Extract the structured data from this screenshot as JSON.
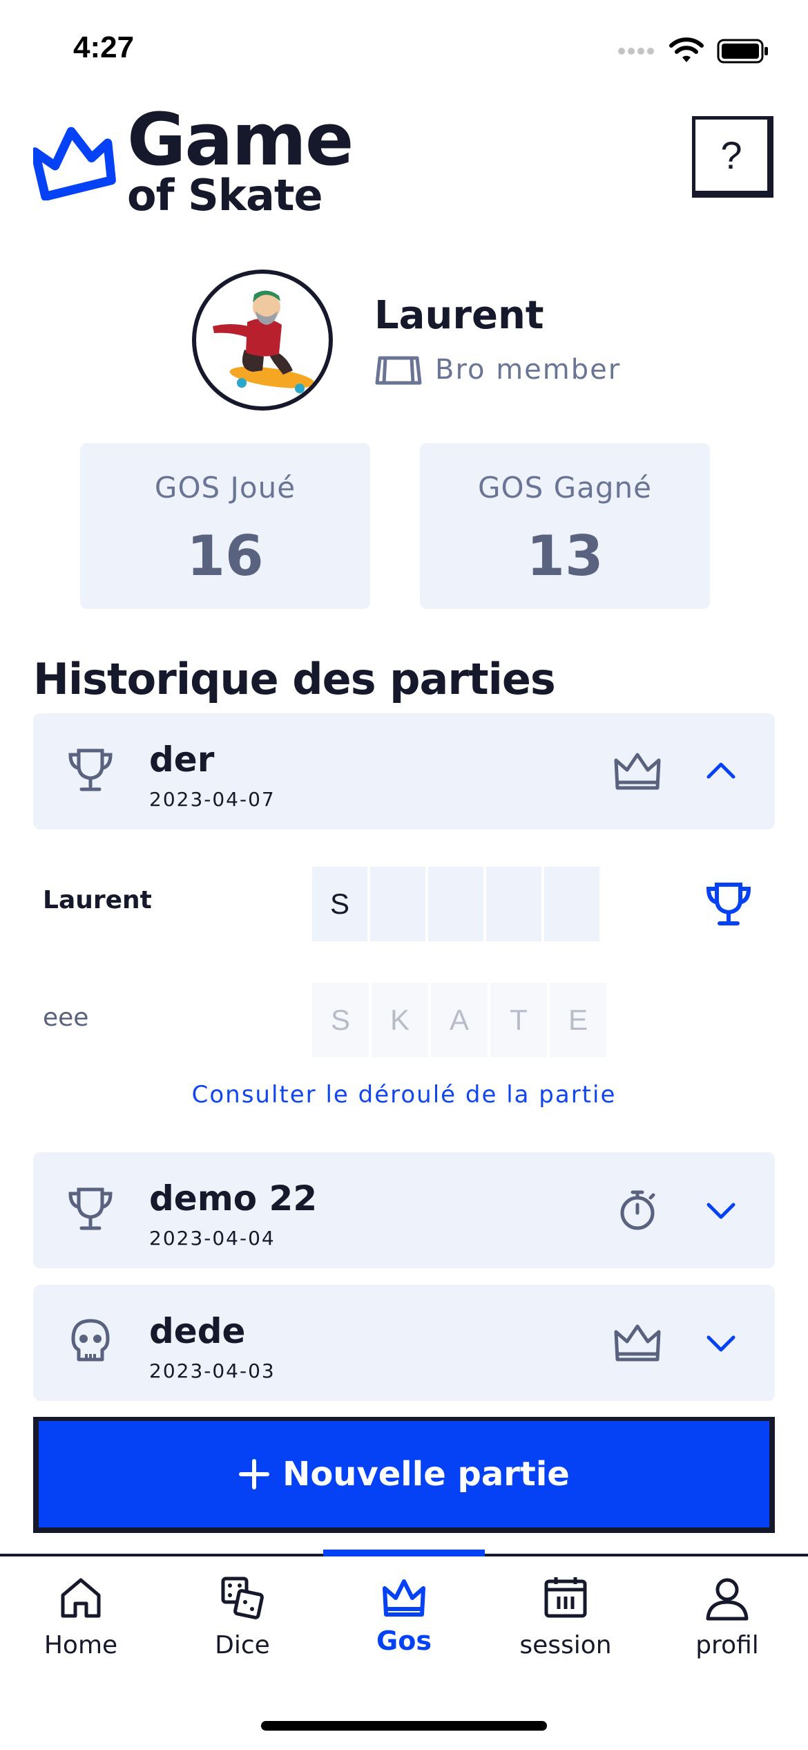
{
  "status_bar": {
    "time": "4:27"
  },
  "header": {
    "logo_line1": "Game",
    "logo_line2": "of Skate",
    "help_label": "?"
  },
  "profile": {
    "name": "Laurent",
    "membership": "Bro member"
  },
  "stats": [
    {
      "label": "GOS Joué",
      "value": "16"
    },
    {
      "label": "GOS Gagné",
      "value": "13"
    }
  ],
  "history": {
    "title": "Historique des parties",
    "games": [
      {
        "name": "der",
        "date": "2023-04-07",
        "result_icon": "trophy-icon",
        "mode_icon": "crown-icon",
        "expanded": true
      },
      {
        "name": "demo 22",
        "date": "2023-04-04",
        "result_icon": "trophy-icon",
        "mode_icon": "stopwatch-icon",
        "expanded": false
      },
      {
        "name": "dede",
        "date": "2023-04-03",
        "result_icon": "skull-icon",
        "mode_icon": "crown-icon",
        "expanded": false
      }
    ],
    "detail": {
      "players": [
        {
          "name": "Laurent",
          "letters": [
            "S",
            "",
            "",
            "",
            ""
          ],
          "winner": true
        },
        {
          "name": "eee",
          "letters": [
            "S",
            "K",
            "A",
            "T",
            "E"
          ],
          "winner": false
        }
      ],
      "consult_link": "Consulter le déroulé de la partie"
    }
  },
  "new_game_button": {
    "label": "Nouvelle partie"
  },
  "nav": {
    "items": [
      {
        "label": "Home",
        "icon": "home-icon"
      },
      {
        "label": "Dice",
        "icon": "dice-icon"
      },
      {
        "label": "Gos",
        "icon": "crown-icon",
        "active": true
      },
      {
        "label": "session",
        "icon": "calendar-icon"
      },
      {
        "label": "profil",
        "icon": "user-icon"
      }
    ]
  },
  "colors": {
    "accent": "#0542f5",
    "dark": "#15192b",
    "card_bg": "#eef2fa",
    "muted": "#6a7595"
  }
}
